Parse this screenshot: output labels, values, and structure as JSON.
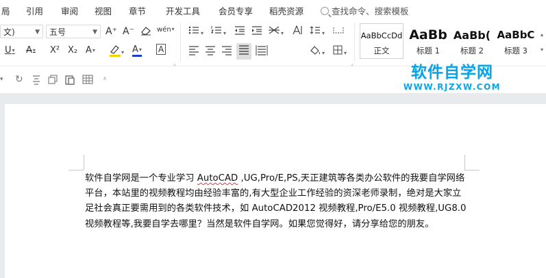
{
  "menu": {
    "items": [
      "局",
      "引用",
      "审阅",
      "视图",
      "章节",
      "开发工具",
      "会员专享",
      "稻壳资源"
    ],
    "search_placeholder": "查找命令、搜索模板"
  },
  "ribbon": {
    "font_name": "文)",
    "font_size": "五号",
    "grow_font": "A⁺",
    "shrink_font": "A⁻",
    "phonetic": "wén",
    "underline": "U",
    "strike": "A",
    "superscript": "X²",
    "subscript": "X₂",
    "text_effect": "A",
    "font_color_letter": "A",
    "char_border": "A",
    "highlight_color": "#f5d400",
    "font_color": "#1a3fd4"
  },
  "styles": [
    {
      "sample": "AaBbCcDd",
      "label": "正文"
    },
    {
      "sample": "AaBb",
      "label": "标题 1"
    },
    {
      "sample": "AaBb(",
      "label": "标题 2"
    },
    {
      "sample": "AaBbC",
      "label": "标题 3"
    }
  ],
  "watermark": {
    "title": "软件自学网",
    "subtitle": "WWW.RJZXW.COM"
  },
  "document": {
    "seg1": "软件自学网是一个专业学习",
    "seg_autocad": "AutoCAD",
    "seg2": ",UG,Pro/E,PS,天正建筑等各类办公软件的我要自学网络平台，本站里的视频教程均由经验丰富的,有大型企业工作经验的资深老师录制，绝对是大家立足社会真正要需用到的各类软件技术，如 AutoCAD2012 视频教程,Pro/E5.0 视频教程,UG8.0 视频教程等,我要自学去哪里？当然是软件自学网。如果您觉得好，请分享给您的朋友。"
  }
}
